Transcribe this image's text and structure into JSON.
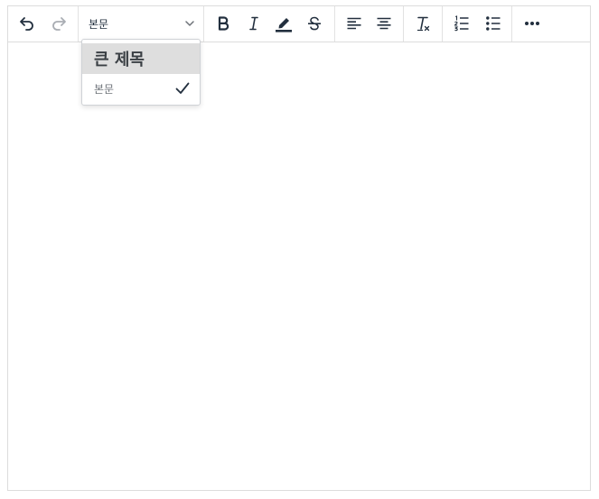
{
  "toolbar": {
    "block_format_value": "본문",
    "buttons": [
      {
        "name": "undo",
        "icon": "undo-icon"
      },
      {
        "name": "redo",
        "icon": "redo-icon"
      },
      {
        "name": "bold",
        "icon": "bold-icon"
      },
      {
        "name": "italic",
        "icon": "italic-icon"
      },
      {
        "name": "highlight",
        "icon": "highlighter-icon"
      },
      {
        "name": "strikethrough",
        "icon": "strikethrough-icon"
      },
      {
        "name": "align-left",
        "icon": "align-left-icon"
      },
      {
        "name": "align-center",
        "icon": "align-center-icon"
      },
      {
        "name": "clear-formatting",
        "icon": "clear-formatting-icon"
      },
      {
        "name": "numbered-list",
        "icon": "numbered-list-icon"
      },
      {
        "name": "bullet-list",
        "icon": "bullet-list-icon"
      },
      {
        "name": "more",
        "icon": "more-icon"
      }
    ]
  },
  "dropdown": {
    "items": [
      {
        "label": "큰 제목",
        "selected": false,
        "hovered": true
      },
      {
        "label": "본문",
        "selected": true,
        "hovered": false
      }
    ]
  },
  "colors": {
    "icon": "#222f3e",
    "icon_disabled": "#a9adb3",
    "border": "#dcdcdc",
    "hover_bg": "#dedede"
  }
}
